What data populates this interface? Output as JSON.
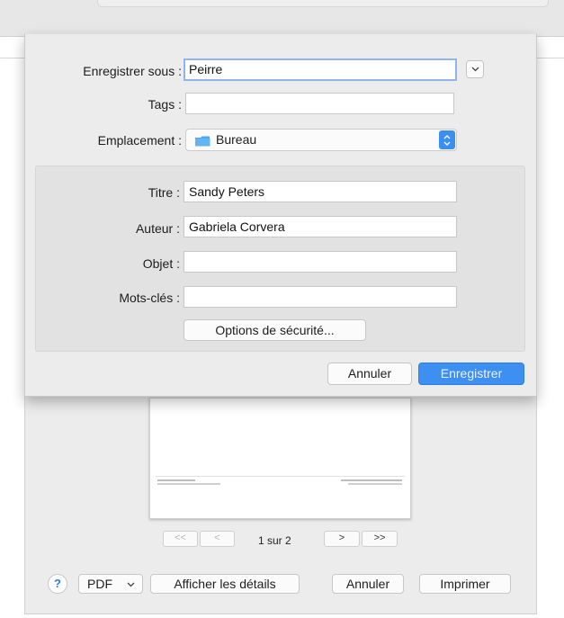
{
  "save_sheet": {
    "save_as_label": "Enregistrer sous :",
    "save_as_value": "Peirre",
    "tags_label": "Tags :",
    "tags_value": "",
    "location_label": "Emplacement :",
    "location_value": "Bureau",
    "metadata": {
      "title_label": "Titre :",
      "title_value": "Sandy Peters",
      "author_label": "Auteur :",
      "author_value": "Gabriela Corvera",
      "subject_label": "Objet :",
      "subject_value": "",
      "keywords_label": "Mots-clés :",
      "keywords_value": "",
      "security_button": "Options de sécurité..."
    },
    "cancel_button": "Annuler",
    "save_button": "Enregistrer"
  },
  "print_panel": {
    "pager": {
      "first": "<<",
      "prev": "<",
      "page_label": "1 sur 2",
      "next": ">",
      "last": ">>"
    },
    "toolbar": {
      "help": "?",
      "pdf_button": "PDF",
      "details_button": "Afficher les détails",
      "cancel_button": "Annuler",
      "print_button": "Imprimer"
    }
  },
  "icons": [
    "chevron-down-icon",
    "folder-icon",
    "stepper-icon",
    "help-icon"
  ],
  "colors": {
    "accent": "#3d8ff1",
    "panel": "#ececec",
    "focus_ring": "#8fb5ec"
  }
}
